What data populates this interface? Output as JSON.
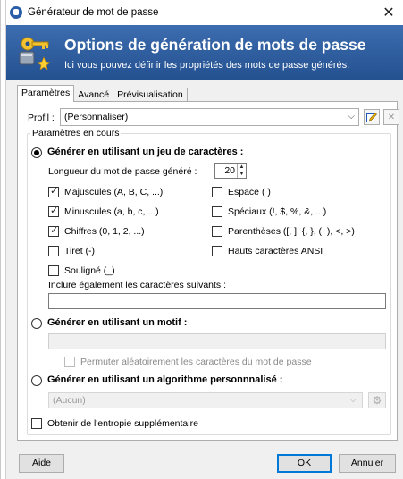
{
  "window": {
    "title": "Générateur de mot de passe",
    "close_glyph": "✕"
  },
  "banner": {
    "title": "Options de génération de mots de passe",
    "subtitle": "Ici vous pouvez définir les propriétés des mots de passe générés."
  },
  "tabs": [
    {
      "label": "Paramètres",
      "active": true
    },
    {
      "label": "Avancé",
      "active": false
    },
    {
      "label": "Prévisualisation",
      "active": false
    }
  ],
  "profile": {
    "label": "Profil :",
    "value": "(Personnaliser)",
    "edit_icon": "edit-profile-icon",
    "delete_icon": "delete-profile-icon"
  },
  "current_settings": {
    "group_label": "Paramètres en cours"
  },
  "charset_mode": {
    "label": "Générer en utilisant un jeu de caractères :",
    "selected": true,
    "length_label": "Longueur du mot de passe généré :",
    "length_value": "20",
    "options": [
      {
        "label": "Majuscules (A, B, C, ...)",
        "checked": true
      },
      {
        "label": "Minuscules (a, b, c, ...)",
        "checked": true
      },
      {
        "label": "Chiffres (0, 1, 2, ...)",
        "checked": true
      },
      {
        "label": "Tiret (-)",
        "checked": false
      },
      {
        "label": "Souligné (_)",
        "checked": false
      },
      {
        "label": "Espace ( )",
        "checked": false
      },
      {
        "label": "Spéciaux (!, $, %, &, ...)",
        "checked": false
      },
      {
        "label": "Parenthèses ([, ], {, }, (, ), <, >)",
        "checked": false
      },
      {
        "label": "Hauts caractères ANSI",
        "checked": false
      }
    ],
    "include_label": "Inclure également les caractères suivants :",
    "include_value": ""
  },
  "pattern_mode": {
    "label": "Générer en utilisant un motif :",
    "selected": false,
    "pattern_value": "",
    "shuffle_label": "Permuter aléatoirement les caractères du mot de passe",
    "shuffle_checked": false
  },
  "algorithm_mode": {
    "label": "Générer en utilisant un algorithme personnnalisé :",
    "selected": false,
    "value": "(Aucun)"
  },
  "entropy": {
    "label": "Obtenir de l'entropie supplémentaire",
    "checked": false
  },
  "footer": {
    "help_label": "Aide",
    "ok_label": "OK",
    "cancel_label": "Annuler"
  },
  "colors": {
    "banner": "#2f5fa3",
    "accent": "#0078d7"
  }
}
